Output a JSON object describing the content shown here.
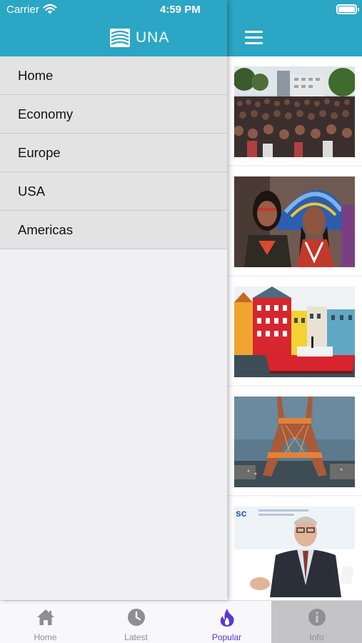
{
  "status_bar": {
    "carrier": "Carrier",
    "time": "4:59 PM"
  },
  "drawer": {
    "logo_text": "UNA",
    "menu_items": [
      {
        "label": "Home"
      },
      {
        "label": "Economy"
      },
      {
        "label": "Europe"
      },
      {
        "label": "USA"
      },
      {
        "label": "Americas"
      }
    ]
  },
  "feed": {
    "items": [
      {
        "image": "crowd-protest-photo"
      },
      {
        "image": "indigenous-women-photo"
      },
      {
        "image": "colorful-harbor-houses-photo"
      },
      {
        "image": "eiffel-tower-photo"
      },
      {
        "image": "speaker-at-conference-photo"
      }
    ]
  },
  "tabbar": {
    "tabs": [
      {
        "label": "Home",
        "icon": "home-icon"
      },
      {
        "label": "Latest",
        "icon": "clock-icon"
      },
      {
        "label": "Popular",
        "icon": "flame-icon",
        "active": true
      },
      {
        "label": "Info",
        "icon": "info-icon"
      }
    ]
  },
  "colors": {
    "header": "#2ba6c4",
    "active_tab": "#5a35d6",
    "inactive_tab": "#8e8e93"
  }
}
